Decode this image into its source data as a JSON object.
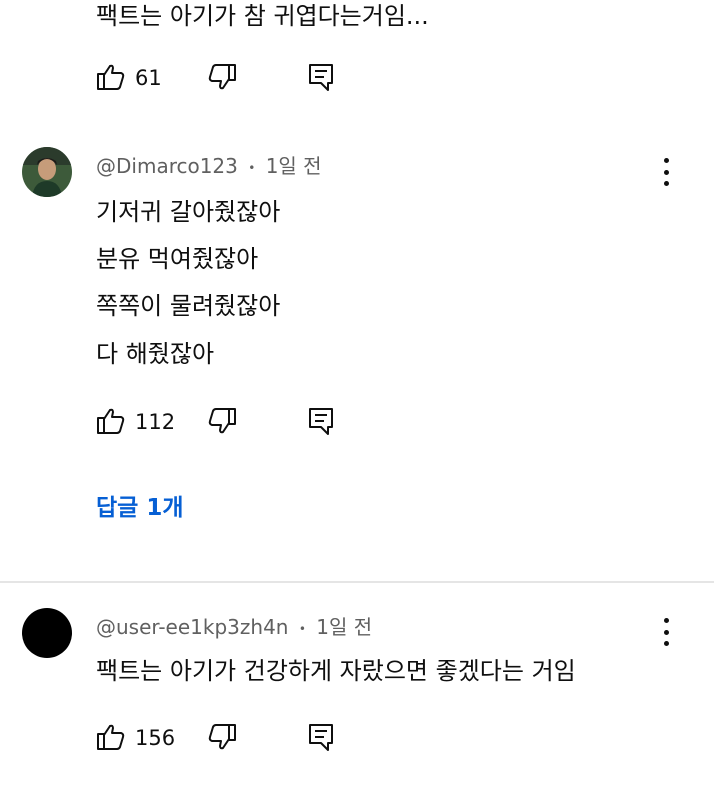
{
  "comment0": {
    "text": "팩트는 아기가 참 귀엽다는거임...",
    "likes": "61"
  },
  "comment1": {
    "author": "@Dimarco123",
    "separator": "•",
    "time": "1일 전",
    "lines": [
      "기저귀 갈아줬잖아",
      "분유 먹여줬잖아",
      "쪽쪽이 물려줬잖아",
      "다 해줬잖아"
    ],
    "likes": "112",
    "replies_label": "답글 1개"
  },
  "comment2": {
    "author": "@user-ee1kp3zh4n",
    "separator": "•",
    "time": "1일 전",
    "text": "팩트는 아기가 건강하게 자랐으면 좋겠다는 거임",
    "likes": "156"
  },
  "colors": {
    "link": "#065fd4",
    "meta": "#606060",
    "divider": "#e5e5e5"
  },
  "icons": [
    "thumbs-up-icon",
    "thumbs-down-icon",
    "reply-icon",
    "more-vert-icon"
  ]
}
